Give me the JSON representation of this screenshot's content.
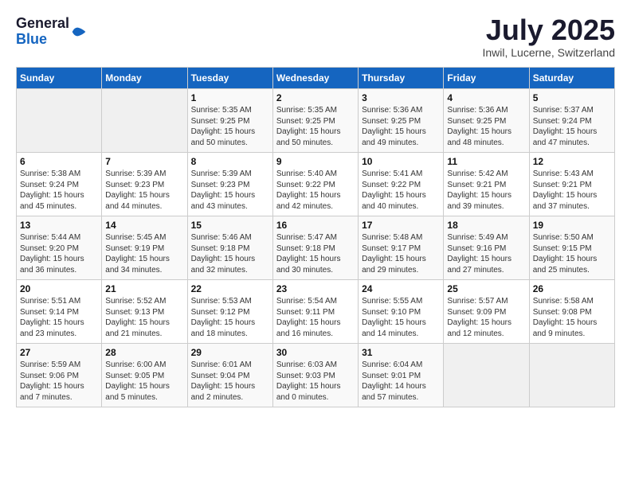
{
  "header": {
    "logo": {
      "line1": "General",
      "line2": "Blue"
    },
    "title": "July 2025",
    "location": "Inwil, Lucerne, Switzerland"
  },
  "weekdays": [
    "Sunday",
    "Monday",
    "Tuesday",
    "Wednesday",
    "Thursday",
    "Friday",
    "Saturday"
  ],
  "weeks": [
    [
      {
        "day": "",
        "info": ""
      },
      {
        "day": "",
        "info": ""
      },
      {
        "day": "1",
        "info": "Sunrise: 5:35 AM\nSunset: 9:25 PM\nDaylight: 15 hours\nand 50 minutes."
      },
      {
        "day": "2",
        "info": "Sunrise: 5:35 AM\nSunset: 9:25 PM\nDaylight: 15 hours\nand 50 minutes."
      },
      {
        "day": "3",
        "info": "Sunrise: 5:36 AM\nSunset: 9:25 PM\nDaylight: 15 hours\nand 49 minutes."
      },
      {
        "day": "4",
        "info": "Sunrise: 5:36 AM\nSunset: 9:25 PM\nDaylight: 15 hours\nand 48 minutes."
      },
      {
        "day": "5",
        "info": "Sunrise: 5:37 AM\nSunset: 9:24 PM\nDaylight: 15 hours\nand 47 minutes."
      }
    ],
    [
      {
        "day": "6",
        "info": "Sunrise: 5:38 AM\nSunset: 9:24 PM\nDaylight: 15 hours\nand 45 minutes."
      },
      {
        "day": "7",
        "info": "Sunrise: 5:39 AM\nSunset: 9:23 PM\nDaylight: 15 hours\nand 44 minutes."
      },
      {
        "day": "8",
        "info": "Sunrise: 5:39 AM\nSunset: 9:23 PM\nDaylight: 15 hours\nand 43 minutes."
      },
      {
        "day": "9",
        "info": "Sunrise: 5:40 AM\nSunset: 9:22 PM\nDaylight: 15 hours\nand 42 minutes."
      },
      {
        "day": "10",
        "info": "Sunrise: 5:41 AM\nSunset: 9:22 PM\nDaylight: 15 hours\nand 40 minutes."
      },
      {
        "day": "11",
        "info": "Sunrise: 5:42 AM\nSunset: 9:21 PM\nDaylight: 15 hours\nand 39 minutes."
      },
      {
        "day": "12",
        "info": "Sunrise: 5:43 AM\nSunset: 9:21 PM\nDaylight: 15 hours\nand 37 minutes."
      }
    ],
    [
      {
        "day": "13",
        "info": "Sunrise: 5:44 AM\nSunset: 9:20 PM\nDaylight: 15 hours\nand 36 minutes."
      },
      {
        "day": "14",
        "info": "Sunrise: 5:45 AM\nSunset: 9:19 PM\nDaylight: 15 hours\nand 34 minutes."
      },
      {
        "day": "15",
        "info": "Sunrise: 5:46 AM\nSunset: 9:18 PM\nDaylight: 15 hours\nand 32 minutes."
      },
      {
        "day": "16",
        "info": "Sunrise: 5:47 AM\nSunset: 9:18 PM\nDaylight: 15 hours\nand 30 minutes."
      },
      {
        "day": "17",
        "info": "Sunrise: 5:48 AM\nSunset: 9:17 PM\nDaylight: 15 hours\nand 29 minutes."
      },
      {
        "day": "18",
        "info": "Sunrise: 5:49 AM\nSunset: 9:16 PM\nDaylight: 15 hours\nand 27 minutes."
      },
      {
        "day": "19",
        "info": "Sunrise: 5:50 AM\nSunset: 9:15 PM\nDaylight: 15 hours\nand 25 minutes."
      }
    ],
    [
      {
        "day": "20",
        "info": "Sunrise: 5:51 AM\nSunset: 9:14 PM\nDaylight: 15 hours\nand 23 minutes."
      },
      {
        "day": "21",
        "info": "Sunrise: 5:52 AM\nSunset: 9:13 PM\nDaylight: 15 hours\nand 21 minutes."
      },
      {
        "day": "22",
        "info": "Sunrise: 5:53 AM\nSunset: 9:12 PM\nDaylight: 15 hours\nand 18 minutes."
      },
      {
        "day": "23",
        "info": "Sunrise: 5:54 AM\nSunset: 9:11 PM\nDaylight: 15 hours\nand 16 minutes."
      },
      {
        "day": "24",
        "info": "Sunrise: 5:55 AM\nSunset: 9:10 PM\nDaylight: 15 hours\nand 14 minutes."
      },
      {
        "day": "25",
        "info": "Sunrise: 5:57 AM\nSunset: 9:09 PM\nDaylight: 15 hours\nand 12 minutes."
      },
      {
        "day": "26",
        "info": "Sunrise: 5:58 AM\nSunset: 9:08 PM\nDaylight: 15 hours\nand 9 minutes."
      }
    ],
    [
      {
        "day": "27",
        "info": "Sunrise: 5:59 AM\nSunset: 9:06 PM\nDaylight: 15 hours\nand 7 minutes."
      },
      {
        "day": "28",
        "info": "Sunrise: 6:00 AM\nSunset: 9:05 PM\nDaylight: 15 hours\nand 5 minutes."
      },
      {
        "day": "29",
        "info": "Sunrise: 6:01 AM\nSunset: 9:04 PM\nDaylight: 15 hours\nand 2 minutes."
      },
      {
        "day": "30",
        "info": "Sunrise: 6:03 AM\nSunset: 9:03 PM\nDaylight: 15 hours\nand 0 minutes."
      },
      {
        "day": "31",
        "info": "Sunrise: 6:04 AM\nSunset: 9:01 PM\nDaylight: 14 hours\nand 57 minutes."
      },
      {
        "day": "",
        "info": ""
      },
      {
        "day": "",
        "info": ""
      }
    ]
  ]
}
